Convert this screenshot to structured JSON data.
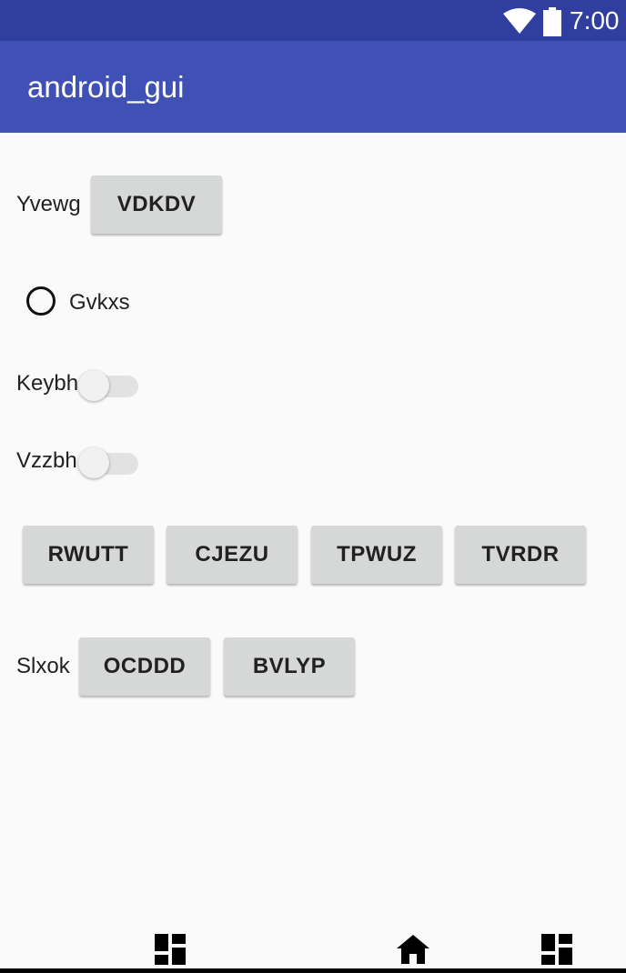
{
  "status_bar": {
    "time": "7:00",
    "icons": [
      "wifi-icon",
      "battery-icon"
    ]
  },
  "app_bar": {
    "title": "android_gui",
    "color": "#3f51b5",
    "status_color": "#303f9f"
  },
  "row1": {
    "label": "Yvewg",
    "button": "VDKDV"
  },
  "radio": {
    "label": "Gvkxs",
    "checked": false
  },
  "switch1": {
    "label": "Keybh",
    "on": false
  },
  "switch2": {
    "label": "Vzzbh",
    "on": false
  },
  "button_row": [
    "RWUTT",
    "CJEZU",
    "TPWUZ",
    "TVRDR"
  ],
  "row_last": {
    "label": "Slxok",
    "buttons": [
      "OCDDD",
      "BVLYP"
    ]
  },
  "nav_bar": {
    "icons": [
      "dashboard-icon",
      "home-icon",
      "dashboard-icon"
    ]
  }
}
